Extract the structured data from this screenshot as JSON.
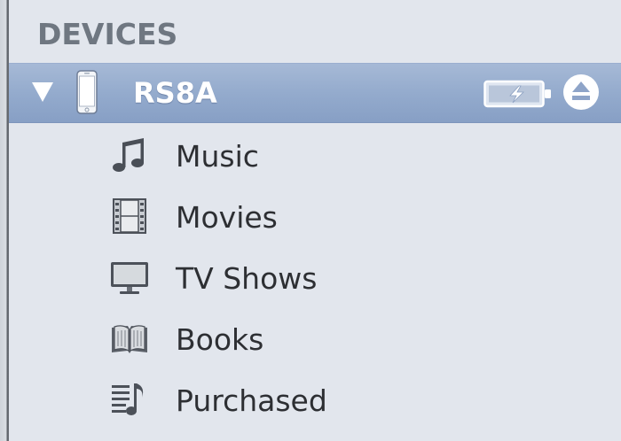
{
  "sidebar": {
    "section_header": "DEVICES",
    "device": {
      "name": "RS8A",
      "icons": {
        "disclosure": "disclosure-triangle-down-icon",
        "device": "phone-icon",
        "battery": "battery-charging-icon",
        "eject": "eject-icon"
      }
    },
    "items": [
      {
        "label": "Music",
        "icon": "music-note-icon"
      },
      {
        "label": "Movies",
        "icon": "film-strip-icon"
      },
      {
        "label": "TV Shows",
        "icon": "tv-monitor-icon"
      },
      {
        "label": "Books",
        "icon": "open-book-icon"
      },
      {
        "label": "Purchased",
        "icon": "purchased-playlist-icon"
      }
    ]
  },
  "colors": {
    "sidebar_bg": "#e2e6ed",
    "selection": "#94abcd",
    "header_text": "#6f7781",
    "item_text": "#2d2f33"
  }
}
